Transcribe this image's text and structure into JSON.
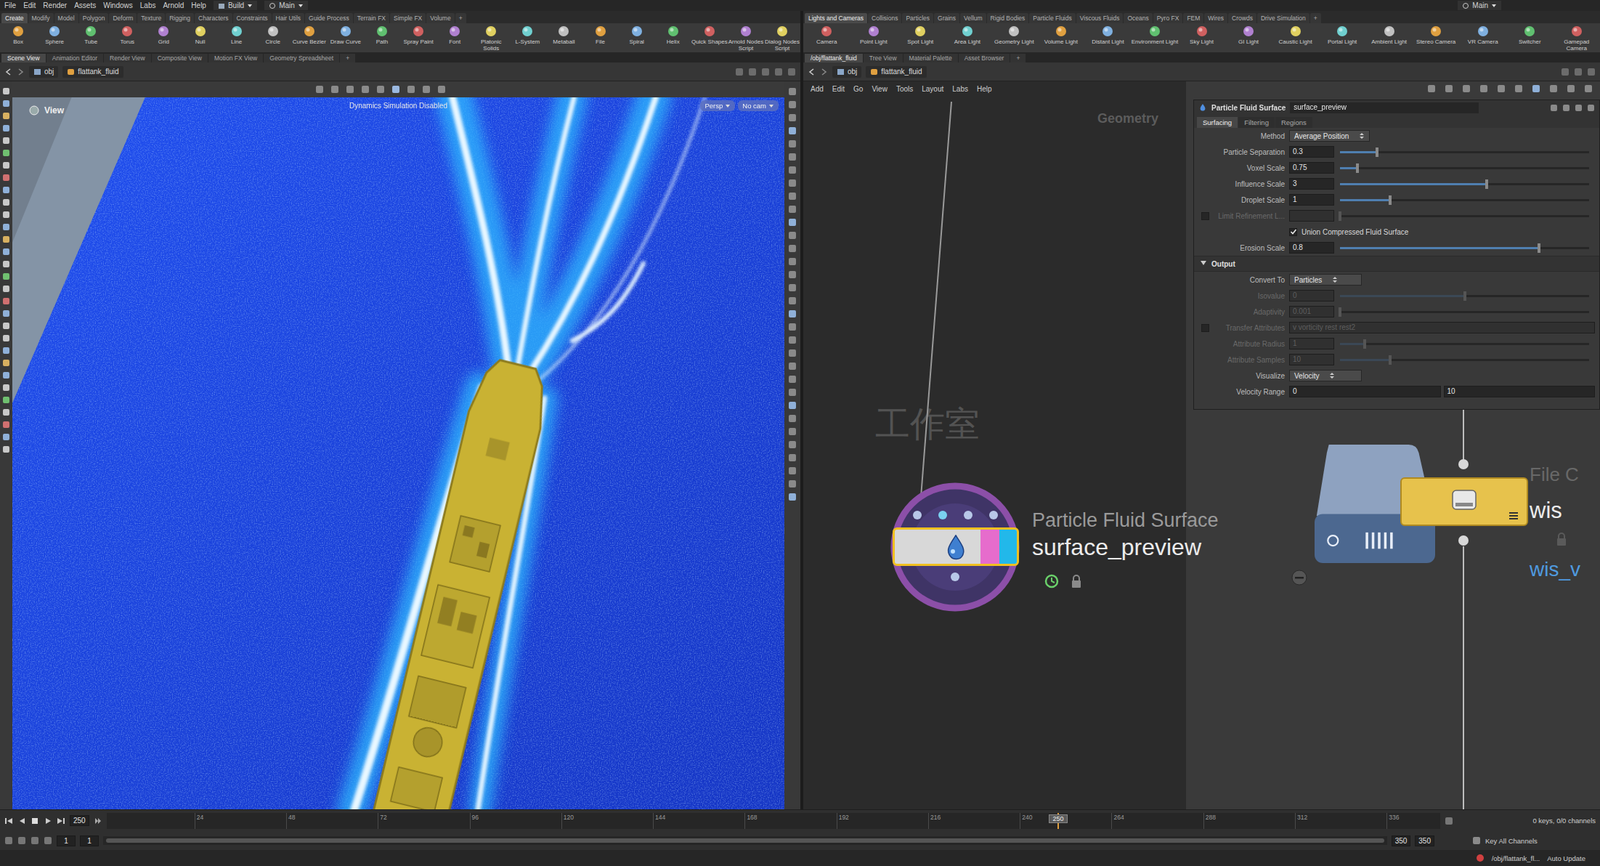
{
  "menubar": {
    "items": [
      "File",
      "Edit",
      "Render",
      "Assets",
      "Windows",
      "Labs",
      "Arnold",
      "Help"
    ],
    "build": "Build",
    "desktop": "Main",
    "right": "Main"
  },
  "shelves": [
    {
      "tabs": [
        {
          "label": "Create",
          "selected": true
        },
        {
          "label": "Modify",
          "selected": false
        },
        {
          "label": "Model",
          "selected": false
        },
        {
          "label": "Polygon",
          "selected": false
        },
        {
          "label": "Deform",
          "selected": false
        },
        {
          "label": "Texture",
          "selected": false
        },
        {
          "label": "Rigging",
          "selected": false
        },
        {
          "label": "Characters",
          "selected": false
        },
        {
          "label": "Constraints",
          "selected": false
        },
        {
          "label": "Hair Utils",
          "selected": false
        },
        {
          "label": "Guide Process",
          "selected": false
        },
        {
          "label": "Terrain FX",
          "selected": false
        },
        {
          "label": "Simple FX",
          "selected": false
        },
        {
          "label": "Volume",
          "selected": false
        }
      ],
      "add": "+",
      "tools": [
        "Box",
        "Sphere",
        "Tube",
        "Torus",
        "Grid",
        "Null",
        "Line",
        "Circle",
        "Curve Bezier",
        "Draw Curve",
        "Path",
        "Spray Paint",
        "Font",
        "Platonic Solids",
        "L-System",
        "Metaball",
        "File",
        "Spiral",
        "Helix",
        "Quick Shapes",
        "Arnold Nodes Script",
        "Dialog Nodes Script"
      ]
    },
    {
      "tabs": [
        {
          "label": "Lights and Cameras",
          "selected": true
        },
        {
          "label": "Collisions",
          "selected": false
        },
        {
          "label": "Particles",
          "selected": false
        },
        {
          "label": "Grains",
          "selected": false
        },
        {
          "label": "Vellum",
          "selected": false
        },
        {
          "label": "Rigid Bodies",
          "selected": false
        },
        {
          "label": "Particle Fluids",
          "selected": false
        },
        {
          "label": "Viscous Fluids",
          "selected": false
        },
        {
          "label": "Oceans",
          "selected": false
        },
        {
          "label": "Pyro FX",
          "selected": false
        },
        {
          "label": "FEM",
          "selected": false
        },
        {
          "label": "Wires",
          "selected": false
        },
        {
          "label": "Crowds",
          "selected": false
        },
        {
          "label": "Drive Simulation",
          "selected": false
        }
      ],
      "add": "+",
      "tools": [
        "Camera",
        "Point Light",
        "Spot Light",
        "Area Light",
        "Geometry Light",
        "Volume Light",
        "Distant Light",
        "Environment Light",
        "Sky Light",
        "GI Light",
        "Caustic Light",
        "Portal Light",
        "Ambient Light",
        "Stereo Camera",
        "VR Camera",
        "Switcher",
        "Gamepad Camera"
      ]
    }
  ],
  "panes": [
    {
      "tabs": [
        {
          "label": "Scene View",
          "selected": true
        },
        {
          "label": "Animation Editor",
          "selected": false
        },
        {
          "label": "Render View",
          "selected": false
        },
        {
          "label": "Composite View",
          "selected": false
        },
        {
          "label": "Motion FX View",
          "selected": false
        },
        {
          "label": "Geometry Spreadsheet",
          "selected": false
        }
      ],
      "add": "+",
      "path": [
        "obj",
        "flattank_fluid"
      ]
    },
    {
      "tabs": [
        {
          "label": "/obj/flattank_fluid",
          "selected": true
        },
        {
          "label": "Tree View",
          "selected": false
        },
        {
          "label": "Material Palette",
          "selected": false
        },
        {
          "label": "Asset Browser",
          "selected": false
        }
      ],
      "add": "+",
      "path": [
        "obj",
        "flattank_fluid"
      ]
    }
  ],
  "viewport": {
    "label": "View",
    "status": "Dynamics Simulation Disabled",
    "persp": "Persp",
    "cam": "No cam"
  },
  "network": {
    "menu": [
      "Add",
      "Edit",
      "Go",
      "View",
      "Tools",
      "Layout",
      "Labs",
      "Help"
    ],
    "context": "Geometry",
    "nodes": [
      {
        "kind": "fluid",
        "type": "Particle Fluid Surface",
        "name": "surface_preview",
        "selected": true
      },
      {
        "kind": "filecache",
        "type": "File C",
        "name": "wis",
        "selected": false
      }
    ],
    "other_label": "wis_v"
  },
  "parameters": {
    "type": "Particle Fluid Surface",
    "name": "surface_preview",
    "tabs": [
      {
        "label": "Surfacing",
        "selected": true
      },
      {
        "label": "Filtering",
        "selected": false
      },
      {
        "label": "Regions",
        "selected": false
      }
    ],
    "rows": [
      {
        "kind": "menu",
        "label": "Method",
        "value": "Average Position",
        "disabled": false
      },
      {
        "kind": "slider",
        "label": "Particle Separation",
        "value": "0.3",
        "level": 0.15,
        "disabled": false
      },
      {
        "kind": "slider",
        "label": "Voxel Scale",
        "value": "0.75",
        "level": 0.07,
        "disabled": false
      },
      {
        "kind": "slider",
        "label": "Influence Scale",
        "value": "3",
        "level": 0.59,
        "disabled": false
      },
      {
        "kind": "slider",
        "label": "Droplet Scale",
        "value": "1",
        "level": 0.2,
        "disabled": false
      },
      {
        "kind": "toggle",
        "label": "Limit Refinement L...",
        "checked": false,
        "value": "",
        "level": 0.0,
        "disabled": true
      },
      {
        "kind": "checkbox",
        "label": "Union Compressed Fluid Surface",
        "checked": true,
        "disabled": false
      },
      {
        "kind": "slider",
        "label": "Erosion Scale",
        "value": "0.8",
        "level": 0.8,
        "disabled": false
      },
      {
        "kind": "section",
        "label": "Output",
        "expanded": true
      },
      {
        "kind": "menu",
        "label": "Convert To",
        "value": "Particles",
        "disabled": false
      },
      {
        "kind": "slider",
        "label": "Isovalue",
        "value": "0",
        "level": 0.5,
        "disabled": true
      },
      {
        "kind": "slider",
        "label": "Adaptivity",
        "value": "0.001",
        "level": 0.0,
        "disabled": true
      },
      {
        "kind": "toggle-text",
        "label": "Transfer Attributes",
        "checked": false,
        "value": "v vorticity rest rest2",
        "disabled": true
      },
      {
        "kind": "slider",
        "label": "Attribute Radius",
        "value": "1",
        "level": 0.1,
        "disabled": true
      },
      {
        "kind": "slider",
        "label": "Attribute Samples",
        "value": "10",
        "level": 0.2,
        "disabled": true
      },
      {
        "kind": "menu",
        "label": "Visualize",
        "value": "Velocity",
        "disabled": false
      },
      {
        "kind": "range",
        "label": "Velocity Range",
        "values": [
          "0",
          "10"
        ],
        "disabled": false
      }
    ]
  },
  "timeline": {
    "frame": "250",
    "marker": "250",
    "level": 0.7135,
    "ticks": [
      "24",
      "48",
      "72",
      "96",
      "120",
      "144",
      "168",
      "192",
      "216",
      "240",
      "264",
      "288",
      "312",
      "336"
    ],
    "range_start": "1",
    "range_start2": "1",
    "range_end": "350",
    "range_end2": "350",
    "keys": "0 keys, 0/0 channels",
    "key_all": "Key All Channels"
  },
  "status_bar": {
    "path": "/obj/flattank_fl...",
    "update": "Auto Update"
  },
  "watermark": "工作室"
}
